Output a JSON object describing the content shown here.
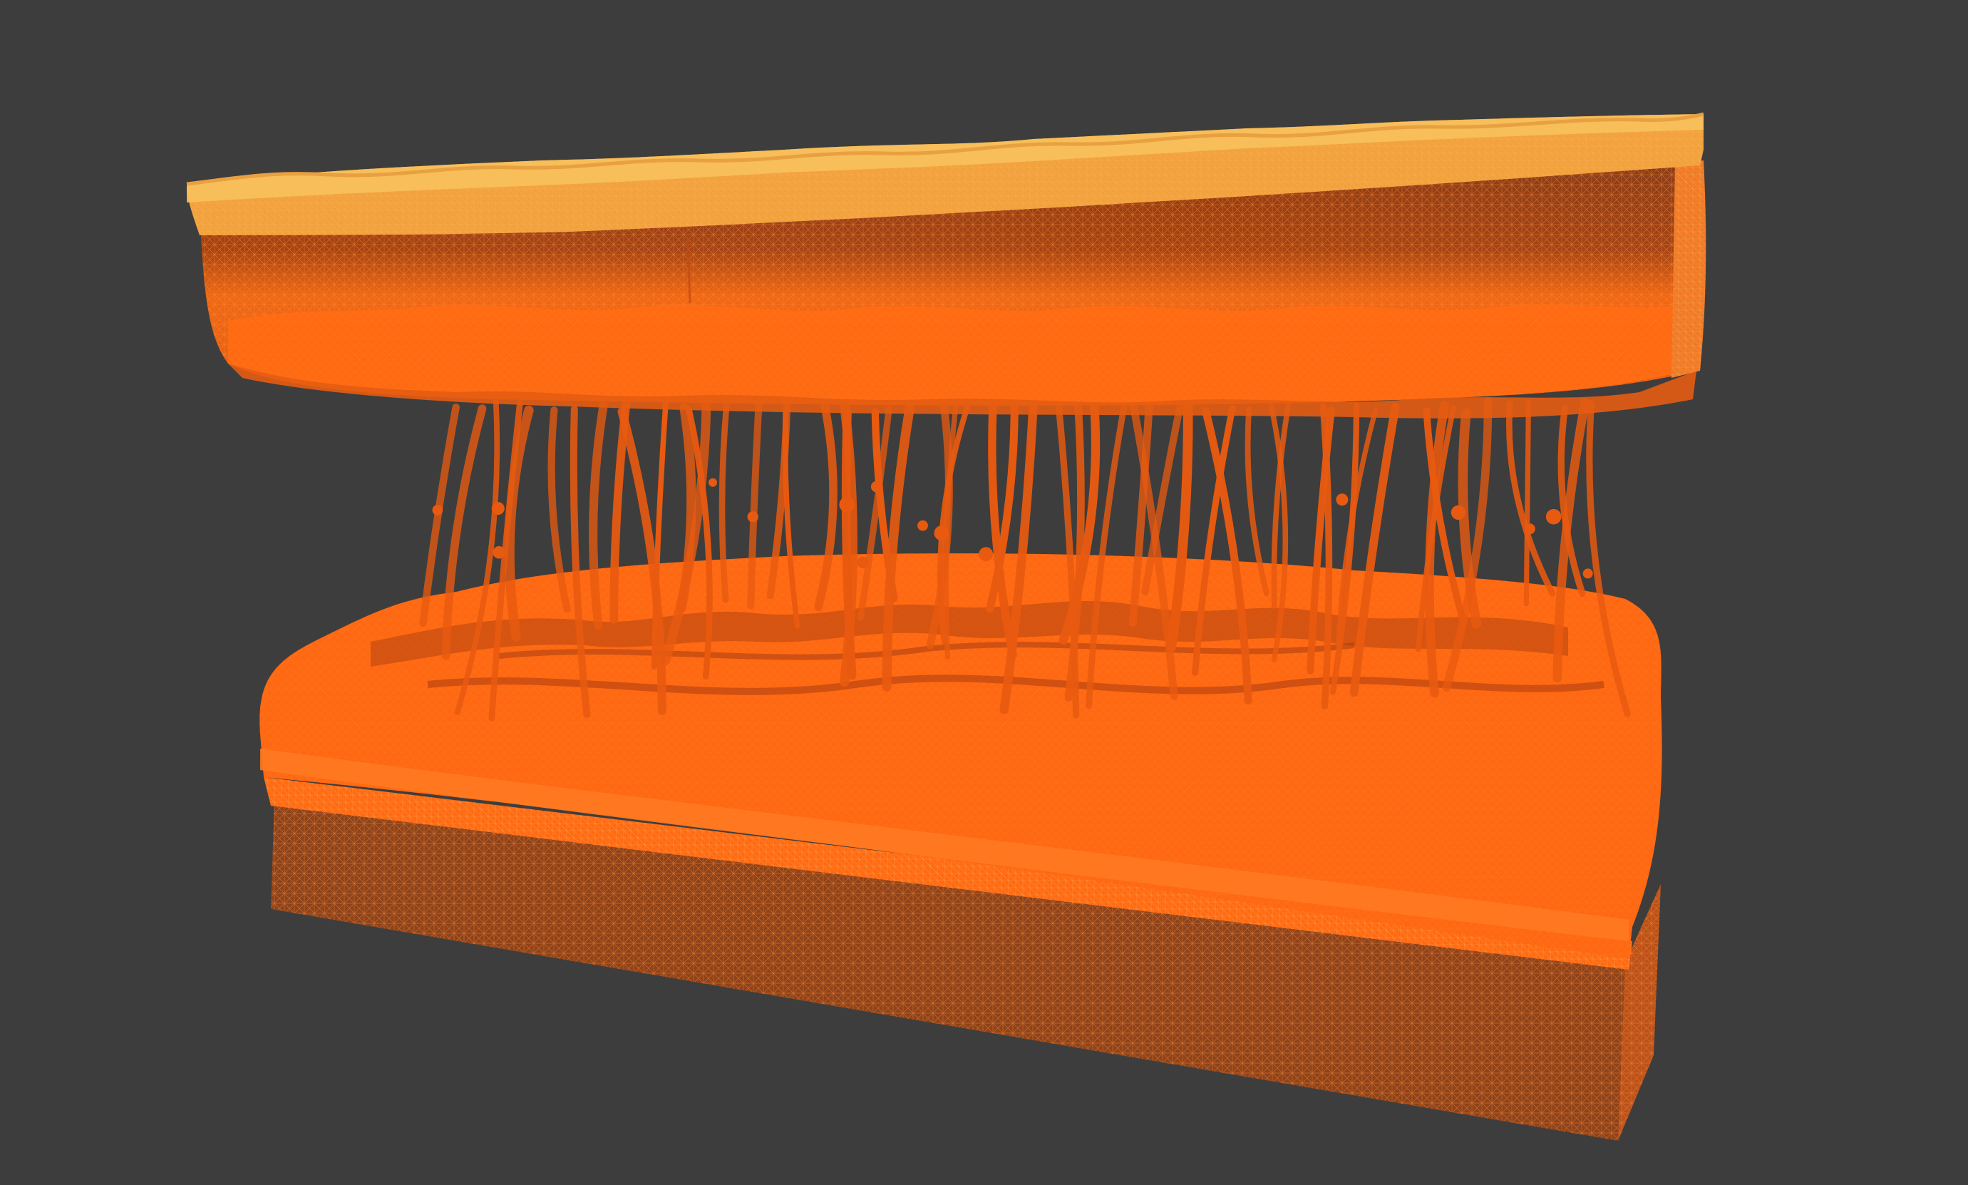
{
  "viewport": {
    "background": "#3d3d3d",
    "render_style": "wireframe"
  },
  "model": {
    "subject": "skin-cross-section",
    "palette": {
      "top_surface": "#f0a838",
      "top_surface_light": "#f6c25a",
      "upper_slab": "#ee6614",
      "upper_slab_dark": "#8a3a14",
      "strands": "#e85a10",
      "lower_block": "#ff6a10",
      "lower_block_dark": "#a04014"
    }
  }
}
